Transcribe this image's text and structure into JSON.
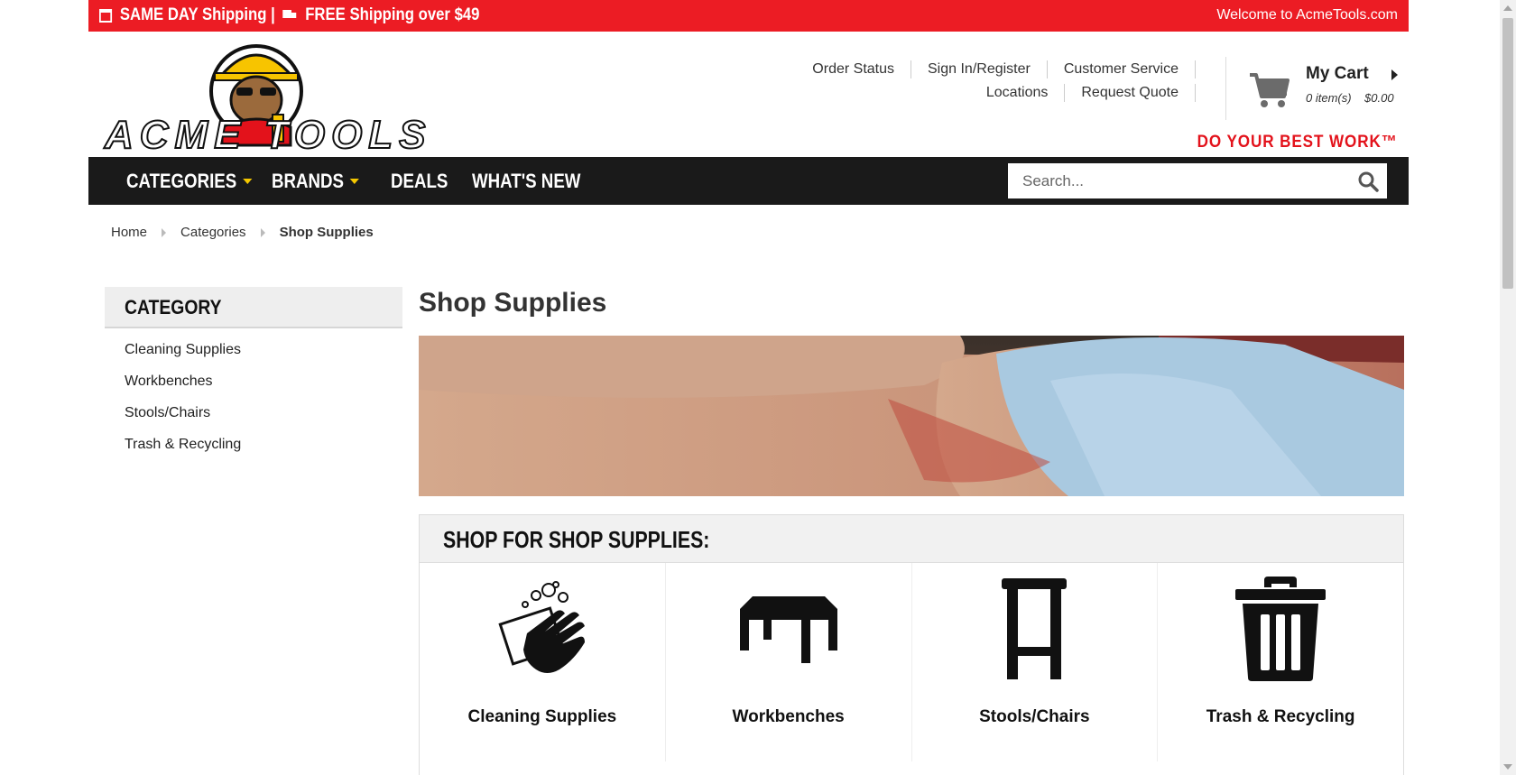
{
  "topbar": {
    "promo_same_day": "SAME DAY Shipping |",
    "promo_free": "FREE Shipping over $49",
    "welcome": "Welcome to AcmeTools.com"
  },
  "header": {
    "logo_text": "ACME TOOLS",
    "links_row1": [
      "Order Status",
      "Sign In/Register",
      "Customer Service"
    ],
    "links_row2": [
      "Locations",
      "Request Quote"
    ],
    "cart": {
      "label": "My Cart",
      "items": "0 item(s)",
      "total": "$0.00"
    },
    "tagline": "DO YOUR BEST WORK™"
  },
  "nav": {
    "items": [
      "CATEGORIES",
      "BRANDS",
      "DEALS",
      "WHAT'S NEW"
    ],
    "search_placeholder": "Search..."
  },
  "breadcrumb": [
    "Home",
    "Categories",
    "Shop Supplies"
  ],
  "sidebar": {
    "title": "CATEGORY",
    "items": [
      "Cleaning Supplies",
      "Workbenches",
      "Stools/Chairs",
      "Trash & Recycling"
    ]
  },
  "main": {
    "title": "Shop Supplies",
    "shop_heading": "SHOP FOR SHOP SUPPLIES:",
    "tiles": [
      {
        "label": "Cleaning Supplies",
        "icon": "cleaning-hand-icon"
      },
      {
        "label": "Workbenches",
        "icon": "workbench-icon"
      },
      {
        "label": "Stools/Chairs",
        "icon": "stool-icon"
      },
      {
        "label": "Trash & Recycling",
        "icon": "trash-can-icon"
      }
    ]
  },
  "colors": {
    "brand_red": "#ec1c24",
    "nav_bg": "#1a1a1a",
    "caret_yellow": "#f5c800"
  }
}
